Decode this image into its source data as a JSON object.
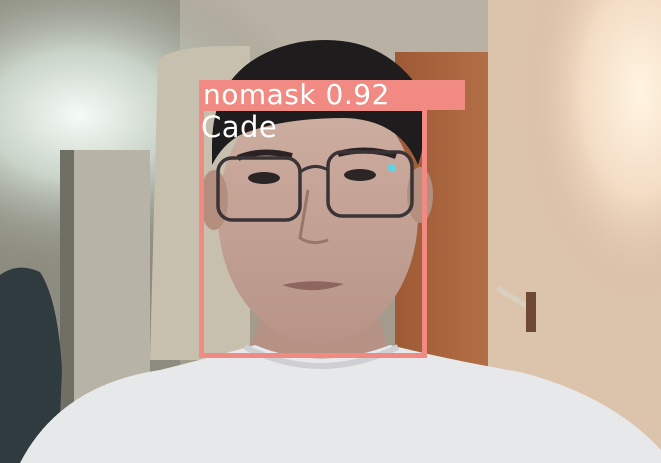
{
  "detection": {
    "class_label": "nomask",
    "confidence": "0.92",
    "label_text": "nomask 0.92",
    "identity": "Cade",
    "box_color": "#f08a82",
    "text_color": "#ffffff"
  }
}
